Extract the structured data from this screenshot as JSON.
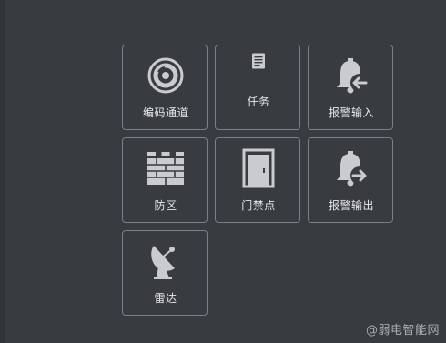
{
  "tiles": [
    {
      "label": "编码通道",
      "icon": "camera-lens-icon"
    },
    {
      "label": "任务",
      "icon": "document-icon"
    },
    {
      "label": "报警输入",
      "icon": "alarm-bell-input-icon"
    },
    {
      "label": "防区",
      "icon": "brick-wall-icon"
    },
    {
      "label": "门禁点",
      "icon": "door-icon"
    },
    {
      "label": "报警输出",
      "icon": "alarm-bell-output-icon"
    },
    {
      "label": "雷达",
      "icon": "radar-dish-icon"
    }
  ],
  "watermark": "@弱电智能网",
  "colors": {
    "background": "#383b40",
    "tile_border": "#7c8087",
    "icon": "#c9cbcf",
    "label": "#e6e8eb"
  }
}
